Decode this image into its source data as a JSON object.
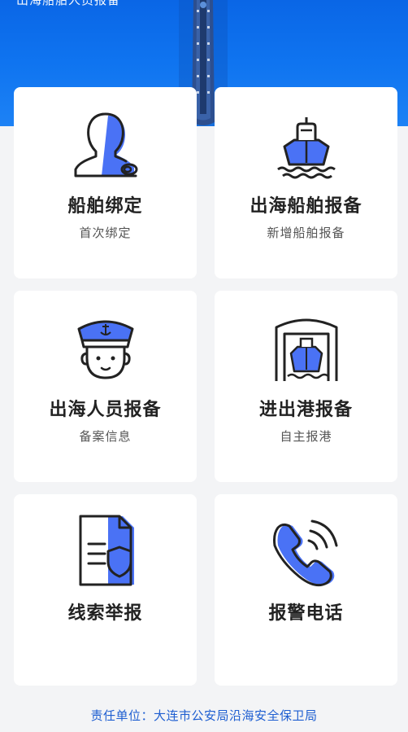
{
  "banner": {
    "subtitle": "出海船舶人员报备"
  },
  "colors": {
    "accent": "#4a72f5",
    "banner_blue": "#0f74f0",
    "icon_stroke": "#222222",
    "footer_text": "#1f5fd1"
  },
  "cards": [
    {
      "title": "船舶绑定",
      "subtitle": "首次绑定",
      "icon": "person-with-rope-icon"
    },
    {
      "title": "出海船舶报备",
      "subtitle": "新增船舶报备",
      "icon": "ship-on-waves-icon"
    },
    {
      "title": "出海人员报备",
      "subtitle": "备案信息",
      "icon": "sailor-captain-icon"
    },
    {
      "title": "进出港报备",
      "subtitle": "自主报港",
      "icon": "ship-in-harbor-gate-icon"
    },
    {
      "title": "线索举报",
      "subtitle": "",
      "icon": "document-shield-icon"
    },
    {
      "title": "报警电话",
      "subtitle": "",
      "icon": "phone-call-icon"
    }
  ],
  "footer": {
    "text": "责任单位：大连市公安局沿海安全保卫局"
  }
}
